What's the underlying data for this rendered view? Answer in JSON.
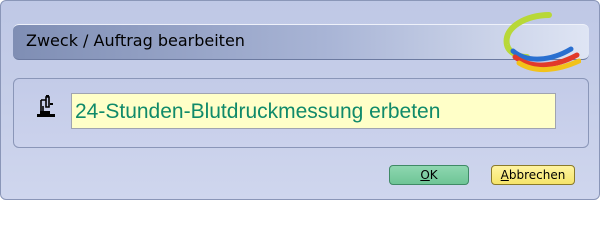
{
  "dialog": {
    "title": "Zweck / Auftrag bearbeiten"
  },
  "purpose": {
    "value": "24-Stunden-Blutdruckmessung erbeten",
    "icon": "microscope-icon"
  },
  "buttons": {
    "ok": {
      "mnemonic": "O",
      "rest": "K"
    },
    "cancel": {
      "mnemonic": "A",
      "rest": "bbrechen"
    }
  },
  "colors": {
    "input_background": "#ffffc8",
    "input_text": "#108a6a",
    "ok_button": "#7fcea3",
    "cancel_button": "#f8ea82"
  }
}
